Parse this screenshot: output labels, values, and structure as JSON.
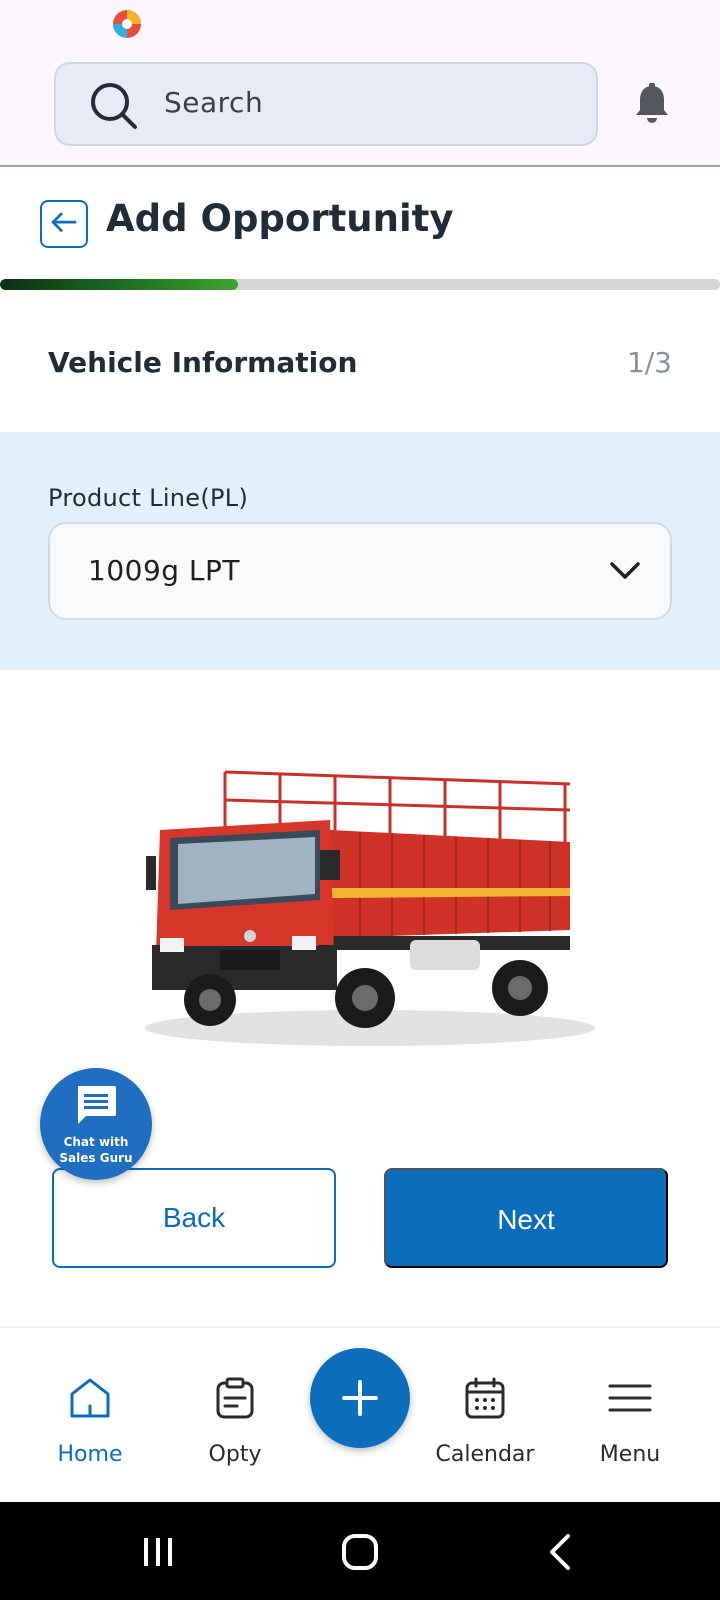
{
  "search": {
    "placeholder": "Search"
  },
  "page": {
    "title": "Add Opportunity"
  },
  "progress": {
    "fraction": 0.33
  },
  "section": {
    "title": "Vehicle Information",
    "step": "1/3"
  },
  "product_line": {
    "label": "Product Line(PL)",
    "selected": "1009g LPT"
  },
  "chat": {
    "line1": "Chat with",
    "line2": "Sales Guru"
  },
  "actions": {
    "back_label": "Back",
    "next_label": "Next"
  },
  "nav": {
    "items": [
      {
        "label": "Home",
        "icon": "home-icon",
        "active": true
      },
      {
        "label": "Opty",
        "icon": "clipboard-icon",
        "active": false
      },
      {
        "label": "Calendar",
        "icon": "calendar-icon",
        "active": false
      },
      {
        "label": "Menu",
        "icon": "hamburger-icon",
        "active": false
      }
    ]
  },
  "colors": {
    "accent": "#0a6ebd",
    "progress_start": "#0d2f12",
    "progress_end": "#3da52e",
    "panel_bg": "#e4f1fb",
    "truck_body": "#d9362b"
  }
}
